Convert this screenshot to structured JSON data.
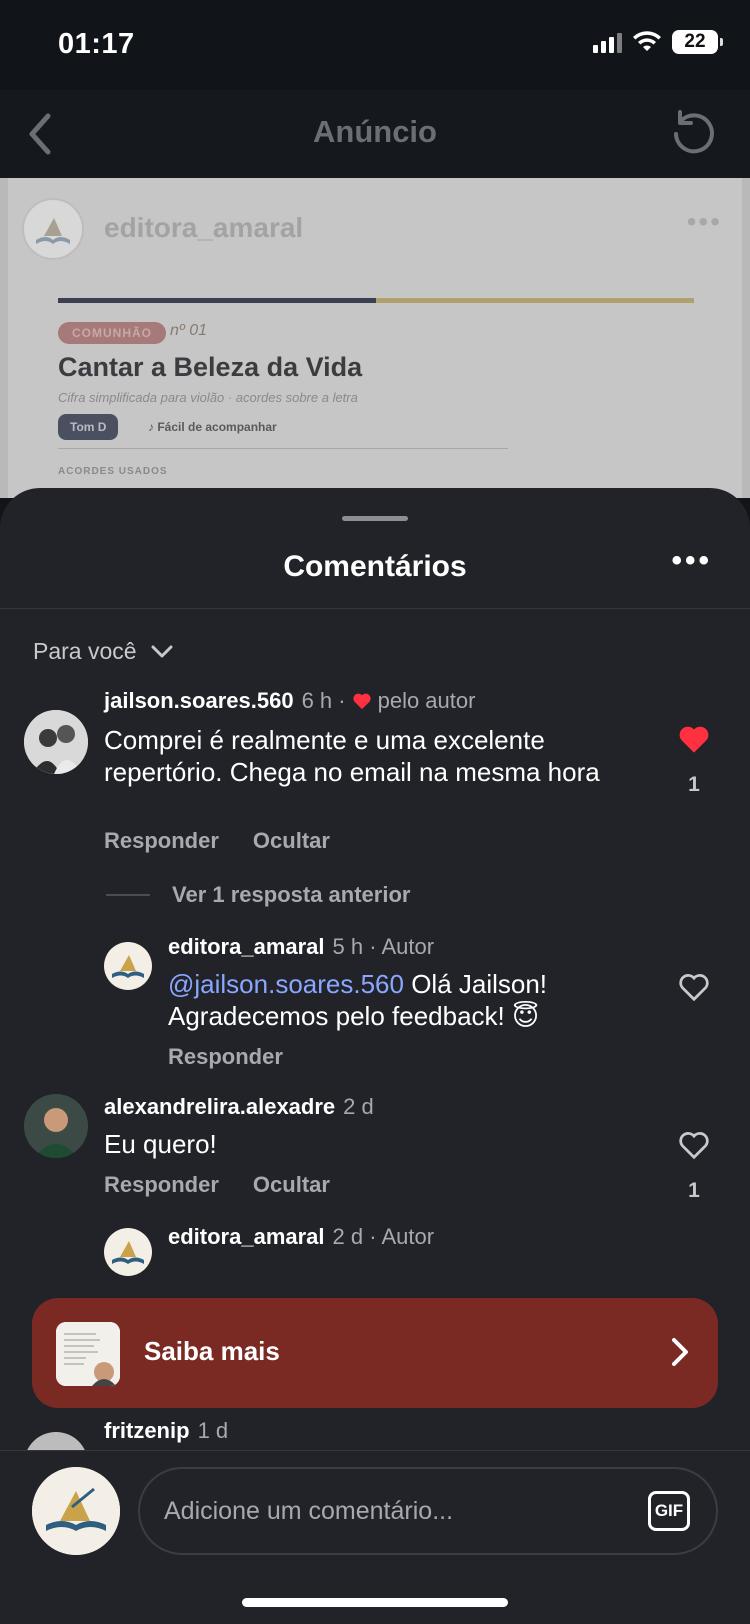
{
  "status_bar": {
    "time": "01:17",
    "battery": "22"
  },
  "header": {
    "title": "Anúncio"
  },
  "ad_preview": {
    "username": "editora_amaral",
    "badge": "COMUNHÃO",
    "number": "nº 01",
    "heading": "Cantar a Beleza da Vida",
    "subtitle": "Cifra simplificada para violão · acordes sobre a letra",
    "tom": "Tom D",
    "easy": "♪ Fácil de acompanhar",
    "chords_label": "ACORDES USADOS"
  },
  "sheet": {
    "title": "Comentários",
    "filter_label": "Para você"
  },
  "comments": [
    {
      "user": "jailson.soares.560",
      "time": "6 h ·",
      "liked_by_author": "pelo autor",
      "text": "Comprei é realmente e uma excelente repertório. Chega no email na mesma hora",
      "reply": "Responder",
      "hide": "Ocultar",
      "likes": "1",
      "liked": true
    },
    {
      "user": "alexandrelira.alexadre",
      "time": "2 d",
      "text": "Eu quero!",
      "reply": "Responder",
      "hide": "Ocultar",
      "likes": "1",
      "liked": false
    }
  ],
  "replies_toggle": "Ver 1 resposta anterior",
  "author_reply": {
    "user": "editora_amaral",
    "time": "5 h · Autor",
    "mention": "@jailson.soares.560",
    "text": " Olá Jailson! Agradecemos pelo feedback! 😇",
    "reply": "Responder"
  },
  "author_reply_2": {
    "user": "editora_amaral",
    "time": "2 d · Autor"
  },
  "partial_comment": {
    "user": "fritzenip",
    "time": "1 d"
  },
  "cta": {
    "label": "Saiba mais"
  },
  "composer": {
    "placeholder": "Adicione um comentário...",
    "gif": "GIF"
  },
  "colors": {
    "accent_like": "#ff3040",
    "cta_bg": "#7b2a23",
    "mention": "#8aa6ff"
  }
}
